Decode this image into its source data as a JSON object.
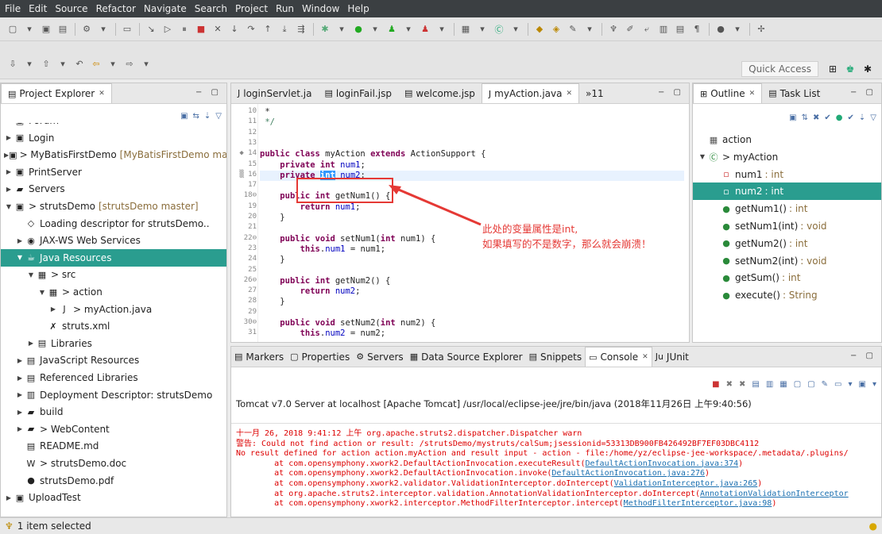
{
  "menu": [
    "File",
    "Edit",
    "Source",
    "Refactor",
    "Navigate",
    "Search",
    "Project",
    "Run",
    "Window",
    "Help"
  ],
  "quick_access": "Quick Access",
  "project_explorer": {
    "title": "Project Explorer",
    "items": [
      {
        "label": "Forum",
        "depth": 1,
        "tw": "",
        "icon": "project-icon"
      },
      {
        "label": "Login",
        "depth": 1,
        "tw": "▶",
        "icon": "project-icon"
      },
      {
        "label": "> MyBatisFirstDemo",
        "dec": "[MyBatisFirstDemo ma",
        "depth": 1,
        "tw": "▶",
        "icon": "project-icon"
      },
      {
        "label": "PrintServer",
        "depth": 1,
        "tw": "▶",
        "icon": "project-icon"
      },
      {
        "label": "Servers",
        "depth": 1,
        "tw": "▶",
        "icon": "folder-icon"
      },
      {
        "label": "> strutsDemo",
        "dec": "[strutsDemo master]",
        "depth": 1,
        "tw": "▼",
        "icon": "project-icon"
      },
      {
        "label": "Loading descriptor for strutsDemo..",
        "depth": 2,
        "tw": "",
        "icon": "loading-icon"
      },
      {
        "label": "JAX-WS Web Services",
        "depth": 2,
        "tw": "▶",
        "icon": "webservice-icon"
      },
      {
        "label": "Java Resources",
        "depth": 2,
        "tw": "▼",
        "icon": "java-resources-icon",
        "selected": true
      },
      {
        "label": "> src",
        "depth": 3,
        "tw": "▼",
        "icon": "package-folder-icon"
      },
      {
        "label": "> action",
        "depth": 4,
        "tw": "▼",
        "icon": "package-icon"
      },
      {
        "label": "> myAction.java",
        "depth": 5,
        "tw": "▶",
        "icon": "java-file-icon"
      },
      {
        "label": "struts.xml",
        "depth": 4,
        "tw": "",
        "icon": "xml-file-icon"
      },
      {
        "label": "Libraries",
        "depth": 3,
        "tw": "▶",
        "icon": "library-icon"
      },
      {
        "label": "JavaScript Resources",
        "depth": 2,
        "tw": "▶",
        "icon": "library-icon"
      },
      {
        "label": "Referenced Libraries",
        "depth": 2,
        "tw": "▶",
        "icon": "library-icon"
      },
      {
        "label": "Deployment Descriptor: strutsDemo",
        "depth": 2,
        "tw": "▶",
        "icon": "descriptor-icon"
      },
      {
        "label": "build",
        "depth": 2,
        "tw": "▶",
        "icon": "folder-icon"
      },
      {
        "label": "> WebContent",
        "depth": 2,
        "tw": "▶",
        "icon": "folder-icon"
      },
      {
        "label": "README.md",
        "depth": 2,
        "tw": "",
        "icon": "md-file-icon"
      },
      {
        "label": "> strutsDemo.doc",
        "depth": 2,
        "tw": "",
        "icon": "doc-file-icon"
      },
      {
        "label": "strutsDemo.pdf",
        "depth": 2,
        "tw": "",
        "icon": "pdf-file-icon"
      },
      {
        "label": "UploadTest",
        "depth": 1,
        "tw": "▶",
        "icon": "project-icon"
      }
    ]
  },
  "editor": {
    "tabs": [
      {
        "label": "loginServlet.ja",
        "icon": "java-file-icon"
      },
      {
        "label": "loginFail.jsp",
        "icon": "jsp-file-icon"
      },
      {
        "label": "welcome.jsp",
        "icon": "jsp-file-icon"
      },
      {
        "label": "myAction.java",
        "icon": "java-file-icon",
        "active": true
      },
      {
        "label": "»11",
        "icon": ""
      }
    ],
    "lines": [
      {
        "n": "10",
        "html": " *",
        "m": ""
      },
      {
        "n": "11",
        "html": " <span class='cmt'>*/</span>",
        "m": ""
      },
      {
        "n": "12",
        "html": "",
        "m": ""
      },
      {
        "n": "13",
        "html": "",
        "m": ""
      },
      {
        "n": "14",
        "html": "<span class='kw'>public class</span> myAction <span class='kw'>extends</span> ActionSupport {",
        "m": "◆"
      },
      {
        "n": "15",
        "html": "    <span class='kw'>private int</span> <span class='fld'>num1</span>;",
        "m": ""
      },
      {
        "n": "16",
        "html": "    <span class='kw'>private</span> <span class='kw selw'>int</span> <span class='fld'>num2</span>;",
        "m": "▒",
        "cur": true
      },
      {
        "n": "17",
        "html": "",
        "m": ""
      },
      {
        "n": "18⊖",
        "html": "    <span class='kw'>public int</span> getNum1() {",
        "m": ""
      },
      {
        "n": "19",
        "html": "        <span class='kw'>return</span> <span class='fld'>num1</span>;",
        "m": ""
      },
      {
        "n": "20",
        "html": "    }",
        "m": ""
      },
      {
        "n": "21",
        "html": "",
        "m": ""
      },
      {
        "n": "22⊖",
        "html": "    <span class='kw'>public void</span> setNum1(<span class='kw'>int</span> num1) {",
        "m": ""
      },
      {
        "n": "23",
        "html": "        <span class='kw'>this</span>.<span class='fld'>num1</span> = num1;",
        "m": ""
      },
      {
        "n": "24",
        "html": "    }",
        "m": ""
      },
      {
        "n": "25",
        "html": "",
        "m": ""
      },
      {
        "n": "26⊖",
        "html": "    <span class='kw'>public int</span> getNum2() {",
        "m": ""
      },
      {
        "n": "27",
        "html": "        <span class='kw'>return</span> <span class='fld'>num2</span>;",
        "m": ""
      },
      {
        "n": "28",
        "html": "    }",
        "m": ""
      },
      {
        "n": "29",
        "html": "",
        "m": ""
      },
      {
        "n": "30⊖",
        "html": "    <span class='kw'>public void</span> setNum2(<span class='kw'>int</span> num2) {",
        "m": ""
      },
      {
        "n": "31",
        "html": "        <span class='kw'>this</span>.<span class='fld'>num2</span> = num2;",
        "m": ""
      }
    ],
    "annotation_lines": [
      "此处的变量属性是int,",
      "如果填写的不是数字，那么就会崩溃！"
    ]
  },
  "outline": {
    "tabs": [
      {
        "label": "Outline",
        "active": true
      },
      {
        "label": "Task List"
      }
    ],
    "items": [
      {
        "label": "action",
        "type": "",
        "icon": "package-icon",
        "indent": 0,
        "tw": ""
      },
      {
        "label": "> myAction",
        "type": "",
        "icon": "class-icon",
        "indent": 0,
        "tw": "▼"
      },
      {
        "label": "num1",
        "type": " : int",
        "icon": "private-field-icon",
        "indent": 1,
        "tw": ""
      },
      {
        "label": "num2",
        "type": " : int",
        "icon": "private-field-icon",
        "indent": 1,
        "tw": "",
        "selected": true
      },
      {
        "label": "getNum1()",
        "type": " : int",
        "icon": "public-method-icon",
        "indent": 1,
        "tw": ""
      },
      {
        "label": "setNum1(int)",
        "type": " : void",
        "icon": "public-method-icon",
        "indent": 1,
        "tw": ""
      },
      {
        "label": "getNum2()",
        "type": " : int",
        "icon": "public-method-icon",
        "indent": 1,
        "tw": ""
      },
      {
        "label": "setNum2(int)",
        "type": " : void",
        "icon": "public-method-icon",
        "indent": 1,
        "tw": ""
      },
      {
        "label": "getSum()",
        "type": " : int",
        "icon": "public-method-icon",
        "indent": 1,
        "tw": ""
      },
      {
        "label": "execute()",
        "type": " : String",
        "icon": "public-method-icon",
        "indent": 1,
        "tw": ""
      }
    ]
  },
  "console": {
    "tabs": [
      {
        "label": "Markers",
        "icon": "markers-icon"
      },
      {
        "label": "Properties",
        "icon": "properties-icon"
      },
      {
        "label": "Servers",
        "icon": "servers-icon"
      },
      {
        "label": "Data Source Explorer",
        "icon": "datasource-icon"
      },
      {
        "label": "Snippets",
        "icon": "snippets-icon"
      },
      {
        "label": "Console",
        "icon": "console-icon",
        "active": true
      },
      {
        "label": "JUnit",
        "icon": "junit-icon"
      }
    ],
    "status": "Tomcat v7.0 Server at localhost [Apache Tomcat] /usr/local/eclipse-jee/jre/bin/java (2018年11月26日 上午9:40:56)",
    "lines": [
      {
        "pre": "十一月 26, 2018 9:41:12 上午 org.apache.struts2.dispatcher.Dispatcher warn",
        "link": "",
        "post": ""
      },
      {
        "pre": "警告: Could not find action or result: /strutsDemo/mystruts/calSum;jsessionid=53313DB900FB426492BF7EF03DBC4112",
        "link": "",
        "post": ""
      },
      {
        "pre": "No result defined for action action.myAction and result input - action - file:/home/yz/eclipse-jee-workspace/.metadata/.plugins/",
        "link": "",
        "post": ""
      },
      {
        "pre": "        at com.opensymphony.xwork2.DefaultActionInvocation.executeResult(",
        "link": "DefaultActionInvocation.java:374",
        "post": ")"
      },
      {
        "pre": "        at com.opensymphony.xwork2.DefaultActionInvocation.invoke(",
        "link": "DefaultActionInvocation.java:276",
        "post": ")"
      },
      {
        "pre": "        at com.opensymphony.xwork2.validator.ValidationInterceptor.doIntercept(",
        "link": "ValidationInterceptor.java:265",
        "post": ")"
      },
      {
        "pre": "        at org.apache.struts2.interceptor.validation.AnnotationValidationInterceptor.doIntercept(",
        "link": "AnnotationValidationInterceptor",
        "post": ""
      },
      {
        "pre": "        at com.opensymphony.xwork2.interceptor.MethodFilterInterceptor.intercept(",
        "link": "MethodFilterInterceptor.java:98",
        "post": ")"
      }
    ]
  },
  "status_bar": {
    "text": "1 item selected"
  }
}
